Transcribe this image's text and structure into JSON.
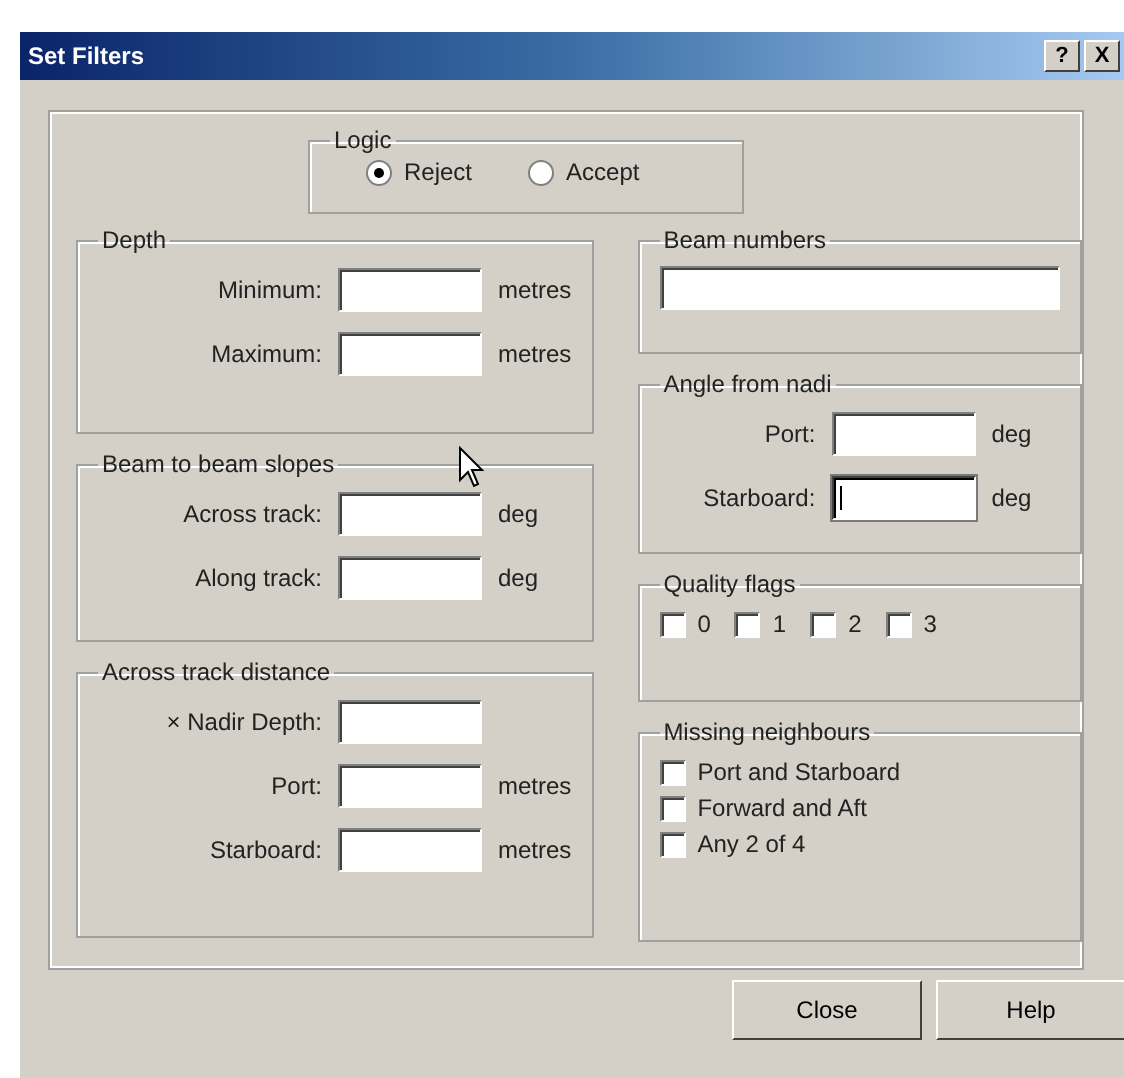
{
  "window": {
    "title": "Set Filters",
    "title_buttons": [
      "?",
      "X"
    ]
  },
  "logic": {
    "label": "Logic",
    "options": [
      {
        "label": "Reject",
        "selected": true
      },
      {
        "label": "Accept",
        "selected": false
      }
    ]
  },
  "depth": {
    "label": "Depth",
    "rows": [
      {
        "label": "Minimum:",
        "unit": "metres"
      },
      {
        "label": "Maximum:",
        "unit": "metres"
      }
    ]
  },
  "beam_slopes": {
    "label": "Beam to beam slopes",
    "rows": [
      {
        "label": "Across track:",
        "unit": "deg"
      },
      {
        "label": "Along track:",
        "unit": "deg"
      }
    ]
  },
  "across_track_distance": {
    "label": "Across track distance",
    "rows": [
      {
        "label": "× Nadir Depth:"
      },
      {
        "label": "Port:",
        "unit": "metres"
      },
      {
        "label": "Starboard:",
        "unit": "metres"
      }
    ]
  },
  "beam_numbers": {
    "label": "Beam numbers"
  },
  "angle_from_nadir": {
    "label": "Angle from nadi",
    "rows": [
      {
        "label": "Port:",
        "unit": "deg",
        "focused": false
      },
      {
        "label": "Starboard:",
        "unit": "deg",
        "focused": true
      }
    ]
  },
  "quality_flags": {
    "label": "Quality flags",
    "flags": [
      {
        "label": "0",
        "checked": false
      },
      {
        "label": "1",
        "checked": false
      },
      {
        "label": "2",
        "checked": false
      },
      {
        "label": "3",
        "checked": false
      }
    ]
  },
  "missing_neighbours": {
    "label": "Missing neighbours",
    "options": [
      {
        "label": "Port and Starboard",
        "checked": false
      },
      {
        "label": "Forward and Aft",
        "checked": false
      },
      {
        "label": "Any 2 of 4",
        "checked": false
      }
    ]
  },
  "buttons": [
    "Close",
    "Help"
  ]
}
